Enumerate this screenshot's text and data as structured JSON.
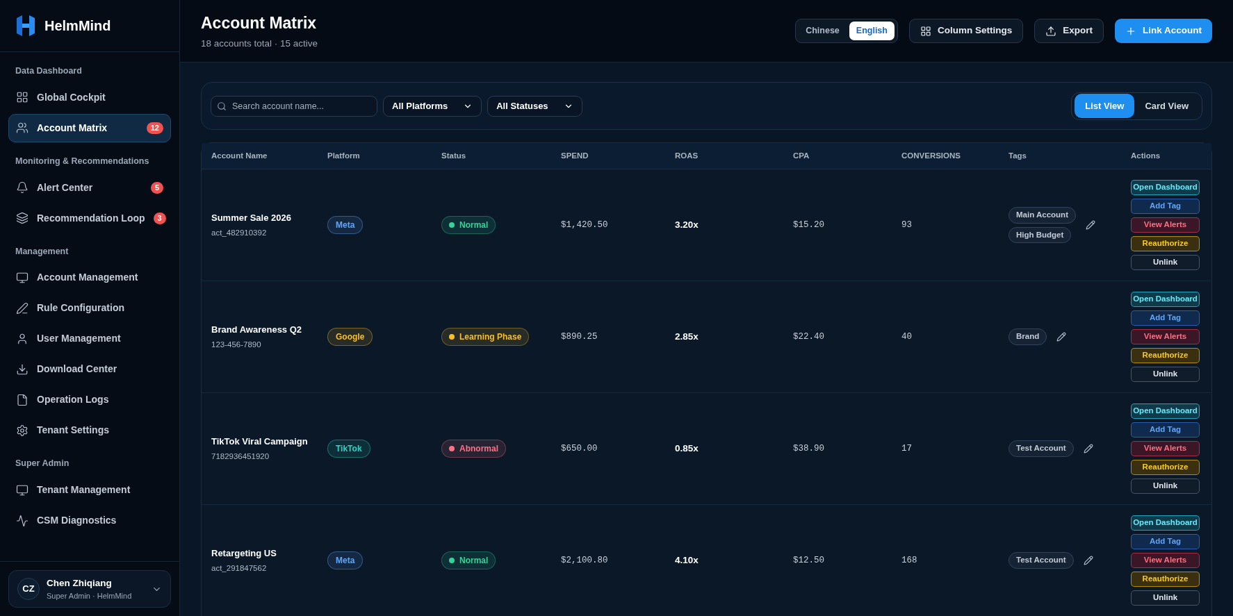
{
  "brand": {
    "name": "HelmMind"
  },
  "sidebar": {
    "sections": [
      {
        "title": "Data Dashboard",
        "items": [
          {
            "kind": "grid",
            "label": "Global Cockpit",
            "selected": false
          },
          {
            "kind": "users",
            "label": "Account Matrix",
            "selected": true,
            "badge": "12"
          }
        ]
      },
      {
        "title": "Monitoring & Recommendations",
        "items": [
          {
            "kind": "bell",
            "label": "Alert Center",
            "selected": false,
            "badge": "5"
          },
          {
            "kind": "layers",
            "label": "Recommendation Loop",
            "selected": false,
            "badge": "3"
          }
        ]
      },
      {
        "title": "Management",
        "items": [
          {
            "kind": "monitor",
            "label": "Account Management",
            "selected": false
          },
          {
            "kind": "pen",
            "label": "Rule Configuration",
            "selected": false
          },
          {
            "kind": "user",
            "label": "User Management",
            "selected": false
          },
          {
            "kind": "download",
            "label": "Download Center",
            "selected": false
          },
          {
            "kind": "file",
            "label": "Operation Logs",
            "selected": false
          },
          {
            "kind": "settings",
            "label": "Tenant Settings",
            "selected": false
          }
        ]
      },
      {
        "title": "Super Admin",
        "items": [
          {
            "kind": "monitor",
            "label": "Tenant Management",
            "selected": false
          },
          {
            "kind": "activity",
            "label": "CSM Diagnostics",
            "selected": false
          }
        ]
      }
    ]
  },
  "user": {
    "initials": "CZ",
    "name": "Chen Zhiqiang",
    "role": "Super Admin · HelmMind"
  },
  "header": {
    "title": "Account Matrix",
    "subtitle": "18 accounts total · 15 active",
    "languages": [
      {
        "label": "Chinese",
        "selected": false
      },
      {
        "label": "English",
        "selected": true
      }
    ],
    "buttons": [
      {
        "kind": "columns",
        "label": "Column Settings"
      },
      {
        "kind": "export",
        "label": "Export"
      },
      {
        "kind": "primary",
        "label": "Link Account"
      }
    ]
  },
  "filters": {
    "search": {
      "placeholder": "Search account name..."
    },
    "selects": [
      "All Platforms",
      "All Statuses"
    ],
    "views": [
      {
        "label": "List View",
        "selected": true
      },
      {
        "label": "Card View",
        "selected": false
      }
    ]
  },
  "table": {
    "columns": [
      "Account Name",
      "Platform",
      "Status",
      "SPEND",
      "ROAS",
      "CPA",
      "CONVERSIONS",
      "Tags",
      "Actions"
    ],
    "rows": [
      {
        "name": "Summer Sale 2026",
        "id": "act_482910392",
        "platform": {
          "label": "Meta",
          "color": "#60a5fa"
        },
        "status": {
          "label": "Normal",
          "color": "#34d399"
        },
        "spend": "$1,420.50",
        "roas": "3.20x",
        "cpa": "$15.20",
        "conversions": "93",
        "tags": [
          "Main Account",
          "High Budget"
        ],
        "actions": [
          {
            "kind": "cyan",
            "label": "Open Dashboard"
          },
          {
            "kind": "blue",
            "label": "Add Tag"
          },
          {
            "kind": "red",
            "label": "View Alerts"
          },
          {
            "kind": "yellow",
            "label": "Reauthorize"
          },
          {
            "kind": "neutral",
            "label": "Unlink"
          }
        ]
      },
      {
        "name": "Brand Awareness Q2",
        "id": "123-456-7890",
        "platform": {
          "label": "Google",
          "color": "#fbbf24"
        },
        "status": {
          "label": "Learning Phase",
          "color": "#fbbf24"
        },
        "spend": "$890.25",
        "roas": "2.85x",
        "cpa": "$22.40",
        "conversions": "40",
        "tags": [
          "Brand"
        ],
        "actions": [
          {
            "kind": "cyan",
            "label": "Open Dashboard"
          },
          {
            "kind": "blue",
            "label": "Add Tag"
          },
          {
            "kind": "red",
            "label": "View Alerts"
          },
          {
            "kind": "yellow",
            "label": "Reauthorize"
          },
          {
            "kind": "neutral",
            "label": "Unlink"
          }
        ]
      },
      {
        "name": "TikTok Viral Campaign",
        "id": "7182936451920",
        "platform": {
          "label": "TikTok",
          "color": "#2dd4bf"
        },
        "status": {
          "label": "Abnormal",
          "color": "#fb7185"
        },
        "spend": "$650.00",
        "roas": "0.85x",
        "cpa": "$38.90",
        "conversions": "17",
        "tags": [
          "Test Account"
        ],
        "actions": [
          {
            "kind": "cyan",
            "label": "Open Dashboard"
          },
          {
            "kind": "blue",
            "label": "Add Tag"
          },
          {
            "kind": "red",
            "label": "View Alerts"
          },
          {
            "kind": "yellow",
            "label": "Reauthorize"
          },
          {
            "kind": "neutral",
            "label": "Unlink"
          }
        ]
      },
      {
        "name": "Retargeting US",
        "id": "act_291847562",
        "platform": {
          "label": "Meta",
          "color": "#60a5fa"
        },
        "status": {
          "label": "Normal",
          "color": "#34d399"
        },
        "spend": "$2,100.80",
        "roas": "4.10x",
        "cpa": "$12.50",
        "conversions": "168",
        "tags": [
          "Test Account"
        ],
        "actions": [
          {
            "kind": "cyan",
            "label": "Open Dashboard"
          },
          {
            "kind": "blue",
            "label": "Add Tag"
          },
          {
            "kind": "red",
            "label": "View Alerts"
          },
          {
            "kind": "yellow",
            "label": "Reauthorize"
          },
          {
            "kind": "neutral",
            "label": "Unlink"
          }
        ]
      }
    ]
  }
}
